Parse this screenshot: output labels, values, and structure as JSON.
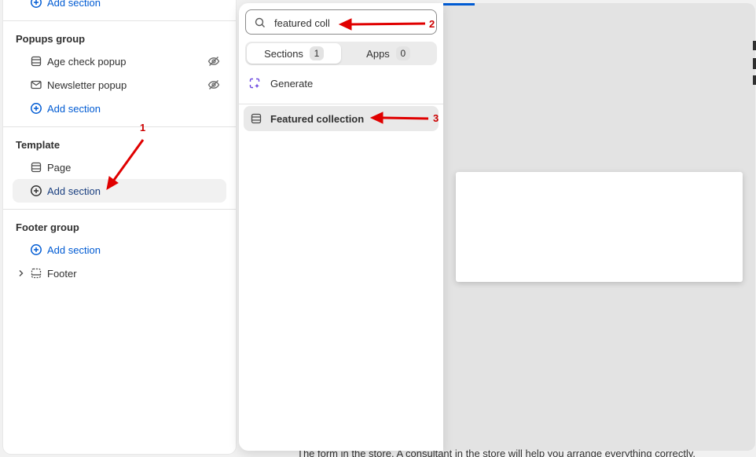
{
  "sidebar": {
    "top_add_section": "Add section",
    "groups": {
      "popups": {
        "title": "Popups group",
        "items": [
          "Age check popup",
          "Newsletter popup"
        ],
        "add": "Add section"
      },
      "template": {
        "title": "Template",
        "items": [
          "Page"
        ],
        "add": "Add section"
      },
      "footer": {
        "title": "Footer group",
        "add": "Add section",
        "items": [
          "Footer"
        ]
      }
    }
  },
  "picker": {
    "search_value": "featured coll",
    "tabs": [
      {
        "label": "Sections",
        "count": "1"
      },
      {
        "label": "Apps",
        "count": "0"
      }
    ],
    "generate": "Generate",
    "results": [
      "Featured collection"
    ]
  },
  "preview": {
    "bottom_text": "The form in the store. A consultant in the store will help you arrange everything correctly."
  },
  "annotations": [
    "1",
    "2",
    "3"
  ],
  "colors": {
    "accent": "#005bd3",
    "annotation": "#cc0000",
    "generate_icon": "#6e4ae0"
  }
}
